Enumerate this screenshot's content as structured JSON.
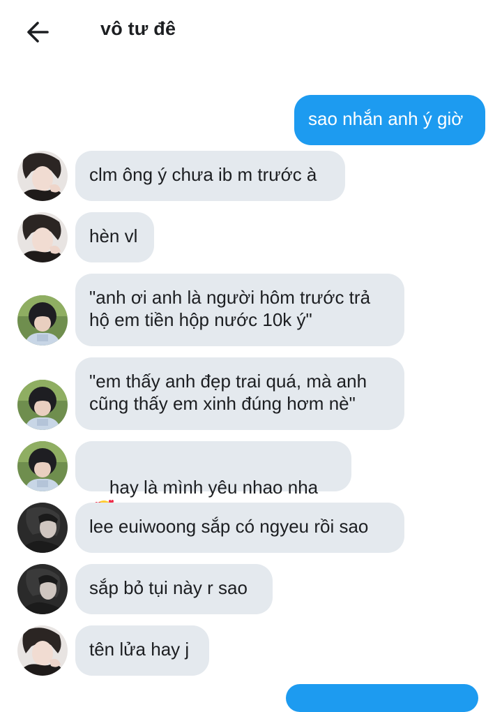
{
  "header": {
    "title": "vô tư đê"
  },
  "messages": [
    {
      "direction": "out",
      "text": "sao nhắn anh ý giờ"
    },
    {
      "direction": "in",
      "avatar": "avatar-a",
      "text": "clm ông ý chưa ib m trước à"
    },
    {
      "direction": "in",
      "avatar": "avatar-a",
      "text": "hèn vl"
    },
    {
      "direction": "in",
      "avatar": "avatar-b",
      "text": "\"anh ơi anh là người hôm trước trả\nhộ em tiền hộp nước 10k ý\""
    },
    {
      "direction": "in",
      "avatar": "avatar-b",
      "text": "\"em thấy anh đẹp trai quá, mà anh\ncũng thấy em xinh đúng hơm nè\""
    },
    {
      "direction": "in",
      "avatar": "avatar-b",
      "text": "hay là mình yêu nhao nha",
      "emoji": "smiling-face-with-hearts-icon"
    },
    {
      "direction": "in",
      "avatar": "avatar-c",
      "text": "lee euiwoong sắp có ngyeu rồi sao"
    },
    {
      "direction": "in",
      "avatar": "avatar-c",
      "text": "sắp bỏ tụi này r sao"
    },
    {
      "direction": "in",
      "avatar": "avatar-a",
      "text": "tên lửa hay j"
    }
  ],
  "colors": {
    "outgoing_bubble": "#1d9bf0",
    "incoming_bubble": "#e4e9ee",
    "text": "#1c1e21"
  },
  "icons": {
    "back": "arrow-left-icon"
  }
}
